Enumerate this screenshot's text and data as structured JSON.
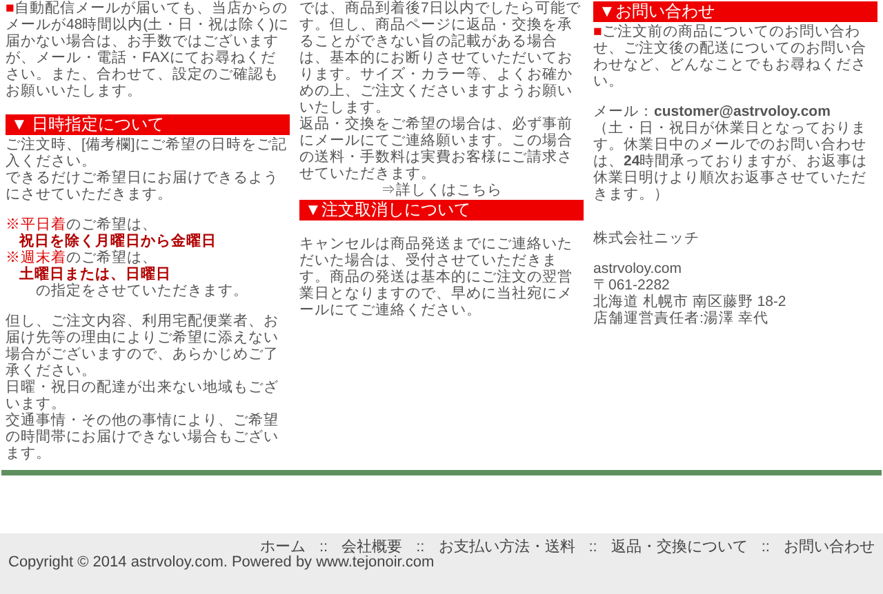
{
  "columns": [
    {
      "blocks": [
        {
          "kind": "note",
          "mark": "■",
          "text": "自動配信メールが届いても、当店からのメールが48時間以内(土・日・祝は除く)に届かない場合は、お手数ではございますが、メール・電話・FAXにてお尋ねください。また、合わせて、設定のご確認もお願いいたします。"
        },
        {
          "kind": "gap"
        },
        {
          "kind": "heading",
          "text": "▼ 日時指定について"
        },
        {
          "kind": "text",
          "text": "ご注文時、[備考欄]にご希望の日時をご記入ください。"
        },
        {
          "kind": "text",
          "text": "できるだけご希望日にお届けできるようにさせていただきます。"
        },
        {
          "kind": "gap"
        },
        {
          "kind": "red_label",
          "label": "※平日着",
          "text": "のご希望は、"
        },
        {
          "kind": "strong",
          "text": "祝日を除く月曜日から金曜日"
        },
        {
          "kind": "red_label",
          "label": "※週末着",
          "text": "のご希望は、"
        },
        {
          "kind": "strong",
          "text": "土曜日または、日曜日"
        },
        {
          "kind": "indent",
          "text": "の指定をさせていただきます。"
        },
        {
          "kind": "gap"
        },
        {
          "kind": "text",
          "text": "但し、ご注文内容、利用宅配便業者、お届け先等の理由によりご希望に添えない場合がございますので、あらかじめご了承ください。"
        },
        {
          "kind": "text",
          "text": "日曜・祝日の配達が出来ない地域もございます。"
        },
        {
          "kind": "text",
          "text": "交通事情・その他の事情により、ご希望の時間帯にお届けできない場合もございます。"
        }
      ]
    },
    {
      "blocks": [
        {
          "kind": "text",
          "text": "では、商品到着後7日以内でしたら可能です。但し、商品ページに返品・交換を承ることができない旨の記載がある場合は、基本的にお断りさせていただいております。サイズ・カラー等、よくお確かめの上、ご注文くださいますようお願いいたします。"
        },
        {
          "kind": "text",
          "text": "返品・交換をご希望の場合は、必ず事前にメールにてご連絡願います。この場合の送料・手数料は実費お客様にご請求させていただきます。"
        },
        {
          "kind": "link",
          "text": "⇒詳しくはこちら"
        },
        {
          "kind": "heading",
          "text": "▼注文取消しについて"
        },
        {
          "kind": "gap"
        },
        {
          "kind": "text",
          "text": "キャンセルは商品発送までにご連絡いただいた場合は、受付させていただきます。商品の発送は基本的にご注文の翌営業日となりますので、早めに当社宛にメールにてご連絡ください。"
        }
      ]
    },
    {
      "blocks": [
        {
          "kind": "heading",
          "text": "▼お問い合わせ"
        },
        {
          "kind": "note",
          "mark": "■",
          "text": "ご注文前の商品についてのお問い合わせ、ご注文後の配送についてのお問い合わせなど、どんなことでもお尋ねください。"
        },
        {
          "kind": "gap"
        },
        {
          "kind": "text",
          "text": "メール：**customer@astrvoloy.com**"
        },
        {
          "kind": "text",
          "text": "（土・日・祝日が休業日となっております。休業日中のメールでのお問い合わせは、**24**時間承っておりますが、お返事は休業日明けより順次お返事させていただきます。）"
        },
        {
          "kind": "gap"
        },
        {
          "kind": "gap"
        },
        {
          "kind": "text",
          "text": "株式会社ニッチ"
        },
        {
          "kind": "gap"
        },
        {
          "kind": "text",
          "text": "astrvoloy.com"
        },
        {
          "kind": "text",
          "text": "〒061-2282"
        },
        {
          "kind": "text",
          "text": "北海道 札幌市 南区藤野 18-2"
        },
        {
          "kind": "text",
          "text": "店舗運営責任者:湯澤 幸代"
        }
      ]
    }
  ],
  "footer": {
    "separator": "::",
    "links": [
      "ホーム",
      "会社概要",
      "お支払い方法・送料",
      "返品・交換について",
      "お問い合わせ"
    ],
    "copyright": "Copyright © 2014 astrvoloy.com. Powered by www.tejonoir.com"
  }
}
